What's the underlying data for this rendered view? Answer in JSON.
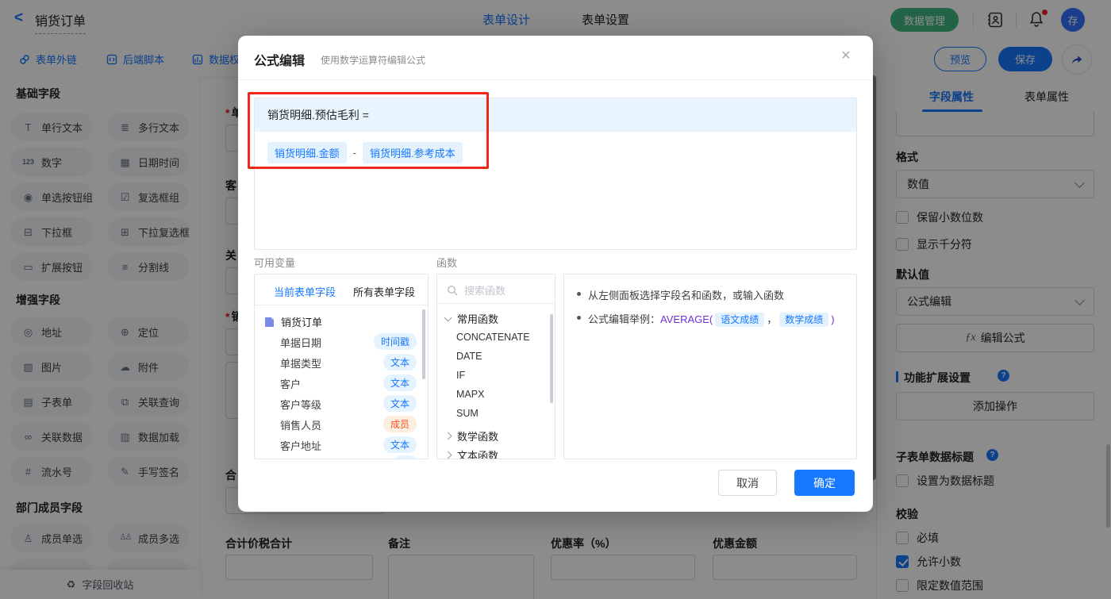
{
  "colors": {
    "primary": "#1677ff",
    "green": "#3eb77e",
    "annotation_red": "#f1271b",
    "purple": "#722ed1",
    "member_orange": "#fa541c",
    "avatar_blue": "#3370ff"
  },
  "topbar": {
    "title": "销货订单",
    "tab_design": "表单设计",
    "tab_settings": "表单设置",
    "data_manage": "数据管理",
    "avatar_text": "存"
  },
  "toolbar": {
    "links": [
      "表单外链",
      "后端脚本",
      "数据权"
    ],
    "preview": "预览",
    "save": "保存"
  },
  "sidebar": {
    "sections": [
      {
        "title": "基础字段",
        "items": [
          "单行文本",
          "多行文本",
          "数字",
          "日期时间",
          "单选按钮组",
          "复选框组",
          "下拉框",
          "下拉复选框",
          "扩展按钮",
          "分割线"
        ]
      },
      {
        "title": "增强字段",
        "items": [
          "地址",
          "定位",
          "图片",
          "附件",
          "子表单",
          "关联查询",
          "关联数据",
          "数据加载",
          "流水号",
          "手写签名"
        ]
      },
      {
        "title": "部门成员字段",
        "items": [
          "成员单选",
          "成员多选"
        ]
      }
    ],
    "recycle": "字段回收站"
  },
  "canvas": {
    "label_fragments": [
      {
        "text": "单",
        "asterisk": "*"
      },
      {
        "text": "客",
        "asterisk": ""
      },
      {
        "text": "关",
        "asterisk": ""
      },
      {
        "text": "销",
        "asterisk": "*"
      },
      {
        "text": "合",
        "asterisk": ""
      }
    ],
    "bottom_fields": [
      {
        "label": "合计价税合计"
      },
      {
        "label": "备注"
      },
      {
        "label": "优惠率（%）"
      },
      {
        "label": "优惠金额"
      }
    ]
  },
  "modal": {
    "title": "公式编辑",
    "subtitle": "使用数学运算符编辑公式",
    "close": "×",
    "formula": {
      "target": "销货明细.预估毛利 =",
      "operand1": "销货明细.金额",
      "operator": "-",
      "operand2": "销货明细.参考成本"
    },
    "variables": {
      "label": "可用变量",
      "tab_current": "当前表单字段",
      "tab_all": "所有表单字段",
      "form_name": "销货订单",
      "fields": [
        {
          "name": "单据日期",
          "badge": "时间戳",
          "kind": "time"
        },
        {
          "name": "单据类型",
          "badge": "文本",
          "kind": "text"
        },
        {
          "name": "客户",
          "badge": "文本",
          "kind": "text"
        },
        {
          "name": "客户等级",
          "badge": "文本",
          "kind": "text"
        },
        {
          "name": "销售人员",
          "badge": "成员",
          "kind": "member"
        },
        {
          "name": "客户地址",
          "badge": "文本",
          "kind": "text"
        }
      ]
    },
    "functions": {
      "label": "函数",
      "search_placeholder": "搜索函数",
      "group_common": "常用函数",
      "common_items": [
        "CONCATENATE",
        "DATE",
        "IF",
        "MAPX",
        "SUM"
      ],
      "group_math": "数学函数",
      "group_text": "文本函数"
    },
    "tips": {
      "line1": "从左侧面板选择字段名和函数，或输入函数",
      "line2_prefix": "公式编辑举例：",
      "fn_open": "AVERAGE(",
      "chip1": "语文成绩",
      "comma": "，",
      "chip2": "数学成绩",
      "fn_close": ")"
    },
    "cancel": "取消",
    "ok": "确定"
  },
  "right_panel": {
    "tab_field": "字段属性",
    "tab_form": "表单属性",
    "format_label": "格式",
    "format_value": "数值",
    "opt_decimal_digits": "保留小数位数",
    "opt_decimal_digits_checked": false,
    "opt_thousand": "显示千分符",
    "opt_thousand_checked": false,
    "default_label": "默认值",
    "default_value": "公式编辑",
    "edit_formula": "编辑公式",
    "fx": "ƒx",
    "ext_title": "功能扩展设置",
    "add_action": "添加操作",
    "subform_title": "子表单数据标题",
    "set_data_title": "设置为数据标题",
    "set_data_title_checked": false,
    "validation_title": "校验",
    "required": "必填",
    "required_checked": false,
    "allow_decimal": "允许小数",
    "allow_decimal_checked": true,
    "limit_range": "限定数值范围",
    "limit_range_checked": false
  }
}
